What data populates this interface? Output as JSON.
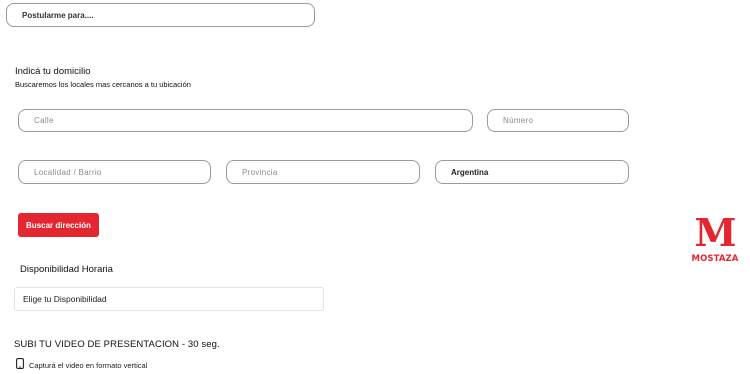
{
  "apply": {
    "value": "Postularme para...."
  },
  "address": {
    "title": "Indicá tu domicilio",
    "subtitle": "Buscaremos los locales mas cercanos a tu ubicación",
    "street_placeholder": "Calle",
    "number_placeholder": "Número",
    "locality_placeholder": "Localidad / Barrio",
    "province_placeholder": "Provincia",
    "country_value": "Argentina",
    "search_button": "Buscar dirección"
  },
  "availability": {
    "title": "Disponibilidad Horaria",
    "select_value": "Elige tu Disponibilidad"
  },
  "video": {
    "title": "SUBI TU VIDEO DE PRESENTACION - 30 seg.",
    "hint": "Capturá el video en formato vertical",
    "hint_icon": "phone-icon"
  },
  "brand": {
    "logo_text": "MOSTAZA",
    "logo_letter": "M",
    "accent_color": "#e3262f"
  }
}
